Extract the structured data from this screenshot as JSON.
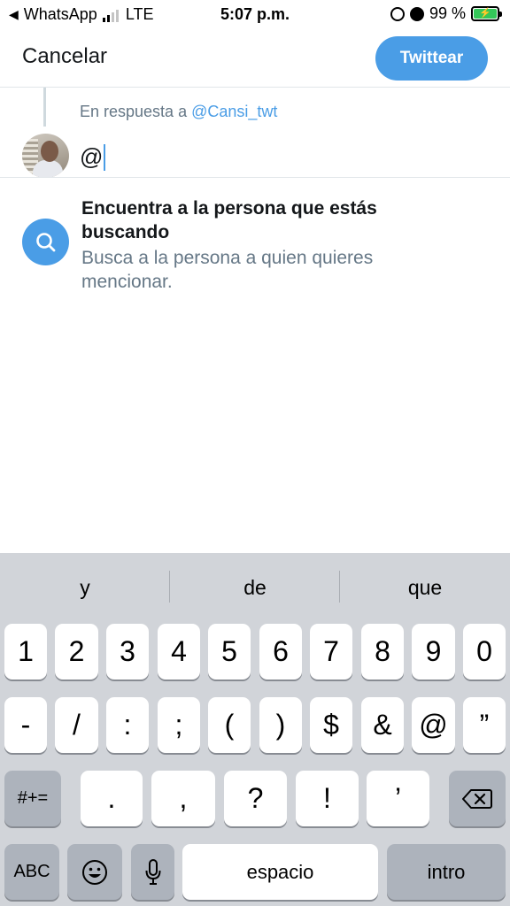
{
  "status_bar": {
    "back_app": "WhatsApp",
    "network": "LTE",
    "time": "5:07 p.m.",
    "battery": "99 %"
  },
  "header": {
    "cancel_label": "Cancelar",
    "tweet_label": "Twittear"
  },
  "reply": {
    "prefix": "En respuesta a",
    "handle": "@Cansi_twt"
  },
  "compose": {
    "text": "@"
  },
  "mention_hint": {
    "title": "Encuentra a la persona que estás buscando",
    "subtitle": "Busca a la persona a quien quieres mencionar."
  },
  "keyboard": {
    "predictions": [
      "y",
      "de",
      "que"
    ],
    "row1": [
      "1",
      "2",
      "3",
      "4",
      "5",
      "6",
      "7",
      "8",
      "9",
      "0"
    ],
    "row2": [
      "-",
      "/",
      ":",
      ";",
      "(",
      ")",
      "$",
      "&",
      "@",
      "”"
    ],
    "row3": {
      "toggle": "#+=",
      "keys": [
        ".",
        ",",
        "?",
        "!",
        "’"
      ]
    },
    "row4": {
      "abc": "ABC",
      "space": "espacio",
      "return": "intro"
    }
  },
  "colors": {
    "accent": "#4a9de6",
    "secondary_text": "#657786",
    "keyboard_bg": "#d1d4d9"
  }
}
